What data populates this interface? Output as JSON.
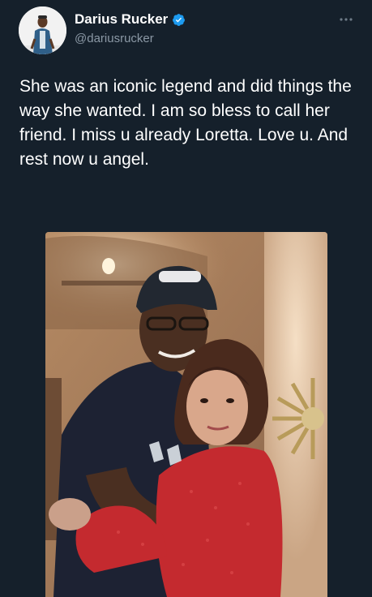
{
  "tweet": {
    "author": {
      "display_name": "Darius Rucker",
      "handle": "@dariusrucker",
      "verified": true,
      "avatar_icon": "profile-photo",
      "verified_icon": "verified-badge-icon"
    },
    "text": "She was an iconic legend and did things the way she wanted. I am so bless to call her friend.  I miss u already Loretta.  Love u. And rest now u angel.",
    "more_icon": "more-options-icon",
    "media": {
      "type": "photo",
      "description_icon": "tweet-photo"
    }
  },
  "colors": {
    "background": "#15202b",
    "handle": "#8b98a5",
    "verified": "#1d9bf0",
    "text": "#ffffff"
  }
}
